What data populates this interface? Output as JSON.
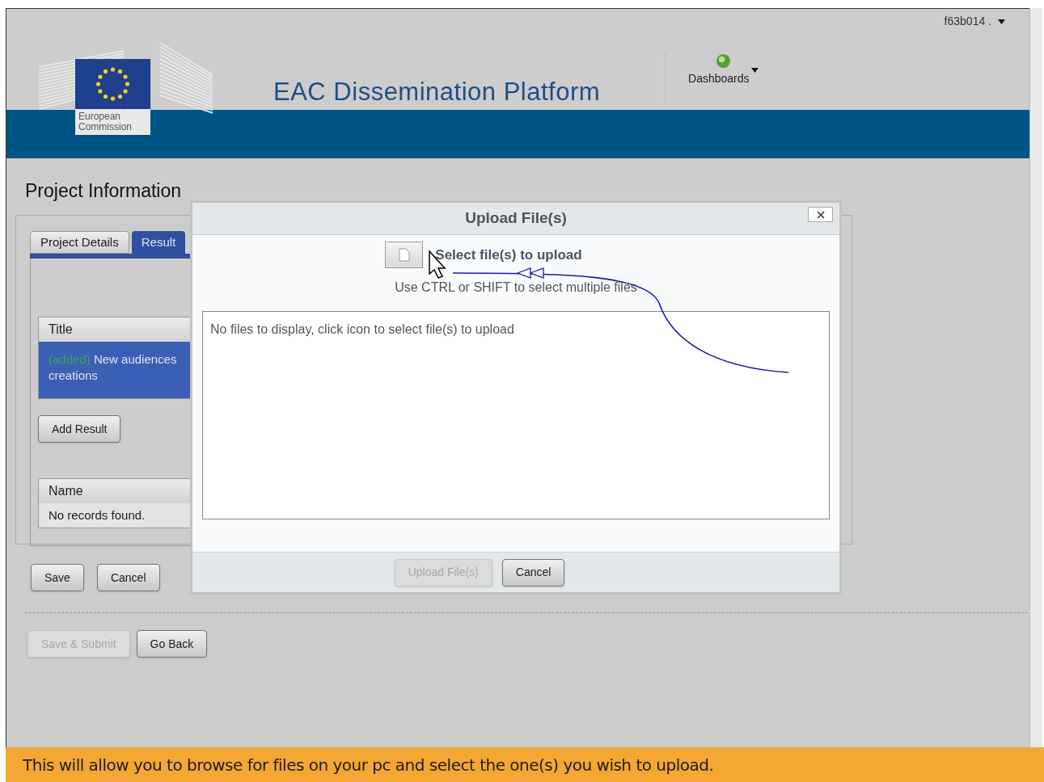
{
  "header": {
    "user_menu": "f63b014 .",
    "logo_text": "European Commission",
    "title": "EAC Dissemination Platform",
    "nav": [
      {
        "label": "Dashboards"
      }
    ]
  },
  "page_title": "Project Information",
  "tabs": [
    {
      "label": "Project Details",
      "selected": false
    },
    {
      "label": "Result",
      "selected": true
    }
  ],
  "results_table": {
    "columns": [
      "Title"
    ],
    "rows": [
      {
        "status": "(added)",
        "lines": [
          "New audiences",
          "creations"
        ],
        "selected": true
      }
    ]
  },
  "add_button": "Add Result",
  "files_table": {
    "columns": [
      "Name"
    ],
    "empty": "No records found."
  },
  "form_buttons": [
    {
      "label": "Save",
      "disabled": false
    },
    {
      "label": "Cancel",
      "disabled": false
    }
  ],
  "footer_buttons": [
    {
      "label": "Save & Submit",
      "disabled": true
    },
    {
      "label": "Go Back",
      "disabled": false
    }
  ],
  "dialog": {
    "title": "Upload File(s)",
    "select_label": "Select file(s) to upload",
    "hint": "Use CTRL or SHIFT to select multiple files",
    "empty": "No files to display, click icon to select file(s) to upload",
    "buttons": [
      {
        "label": "Upload File(s)",
        "disabled": true
      },
      {
        "label": "Cancel",
        "disabled": false
      }
    ]
  },
  "help_bar": "This will allow you to browse for files on your pc and select the one(s) you wish to upload."
}
